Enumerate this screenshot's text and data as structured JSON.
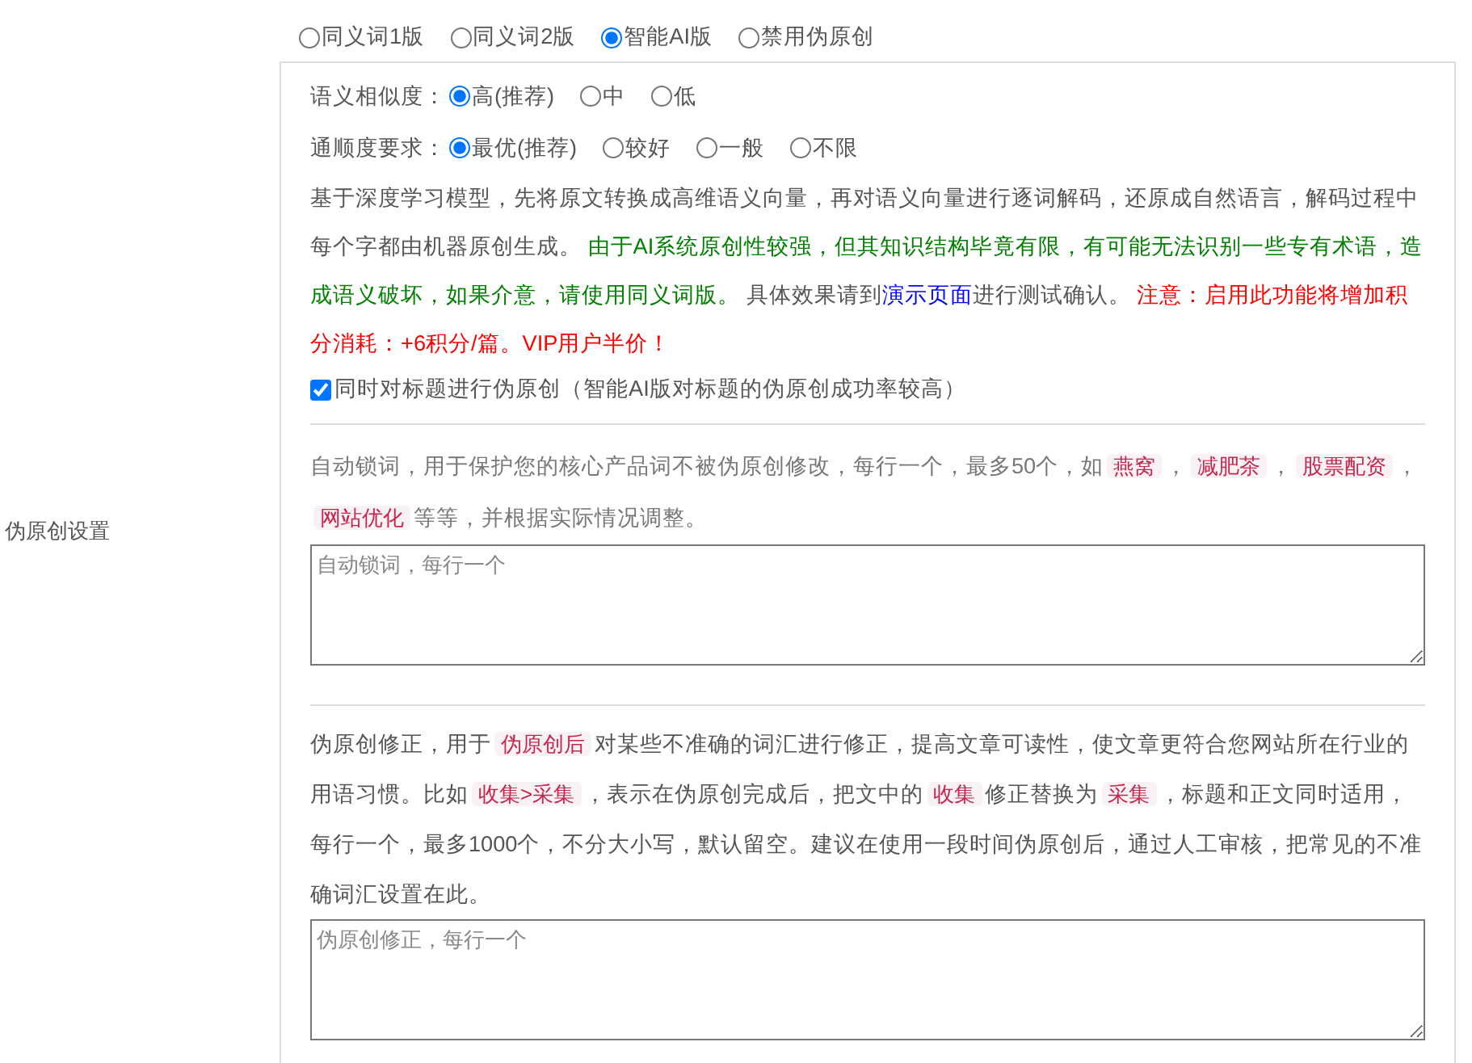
{
  "side_label": "伪原创设置",
  "modes": [
    {
      "label": "同义词1版",
      "selected": false
    },
    {
      "label": "同义词2版",
      "selected": false
    },
    {
      "label": "智能AI版",
      "selected": true
    },
    {
      "label": "禁用伪原创",
      "selected": false
    }
  ],
  "option_rows": [
    {
      "label": "语义相似度：",
      "options": [
        {
          "label": "高(推荐)",
          "selected": true
        },
        {
          "label": "中",
          "selected": false
        },
        {
          "label": "低",
          "selected": false
        }
      ]
    },
    {
      "label": "通顺度要求：",
      "options": [
        {
          "label": "最优(推荐)",
          "selected": true
        },
        {
          "label": "较好",
          "selected": false
        },
        {
          "label": "一般",
          "selected": false
        },
        {
          "label": "不限",
          "selected": false
        }
      ]
    }
  ],
  "ai_description": [
    {
      "kind": "plain",
      "text": "基于深度学习模型，先将原文转换成高维语义向量，再对语义向量进行逐词解码，还原成自然语言，解码过程中每个字都由机器原创生成。 "
    },
    {
      "kind": "success",
      "text": "由于AI系统原创性较强，但其知识结构毕竟有限，有可能无法识别一些专有术语，造成语义破坏，如果介意，请使用同义词版。"
    },
    {
      "kind": "plain",
      "text": " 具体效果请到"
    },
    {
      "kind": "link",
      "text": "演示页面"
    },
    {
      "kind": "plain",
      "text": "进行测试确认。 "
    },
    {
      "kind": "warning",
      "text": "注意：启用此功能将增加积分消耗：+6积分/篇。VIP用户半价！"
    }
  ],
  "title_option": {
    "label": "同时对标题进行伪原创（智能AI版对标题的伪原创成功率较高）",
    "checked": true
  },
  "lock_words": {
    "description": [
      {
        "kind": "plain",
        "text": "自动锁词，用于保护您的核心产品词不被伪原创修改，每行一个，最多50个，如"
      },
      {
        "kind": "code",
        "text": "燕窝"
      },
      {
        "kind": "plain",
        "text": "，"
      },
      {
        "kind": "code",
        "text": "减肥茶"
      },
      {
        "kind": "plain",
        "text": "，"
      },
      {
        "kind": "code",
        "text": "股票配资"
      },
      {
        "kind": "plain",
        "text": "，"
      },
      {
        "kind": "code",
        "text": "网站优化"
      },
      {
        "kind": "plain",
        "text": "等等，并根据实际情况调整。"
      }
    ],
    "placeholder": "自动锁词，每行一个"
  },
  "corrections": {
    "description": [
      {
        "kind": "plain",
        "text": "伪原创修正，用于"
      },
      {
        "kind": "code",
        "text": "伪原创后"
      },
      {
        "kind": "plain",
        "text": "对某些不准确的词汇进行修正，提高文章可读性，使文章更符合您网站所在行业的用语习惯。比如"
      },
      {
        "kind": "code",
        "text": "收集>采集"
      },
      {
        "kind": "plain",
        "text": "，表示在伪原创完成后，把文中的"
      },
      {
        "kind": "code",
        "text": "收集"
      },
      {
        "kind": "plain",
        "text": "修正替换为"
      },
      {
        "kind": "code",
        "text": "采集"
      },
      {
        "kind": "plain",
        "text": "，标题和正文同时适用，每行一个，最多1000个，不分大小写，默认留空。建议在使用一段时间伪原创后，通过人工审核，把常见的不准确词汇设置在此。"
      }
    ],
    "placeholder": "伪原创修正，每行一个"
  }
}
